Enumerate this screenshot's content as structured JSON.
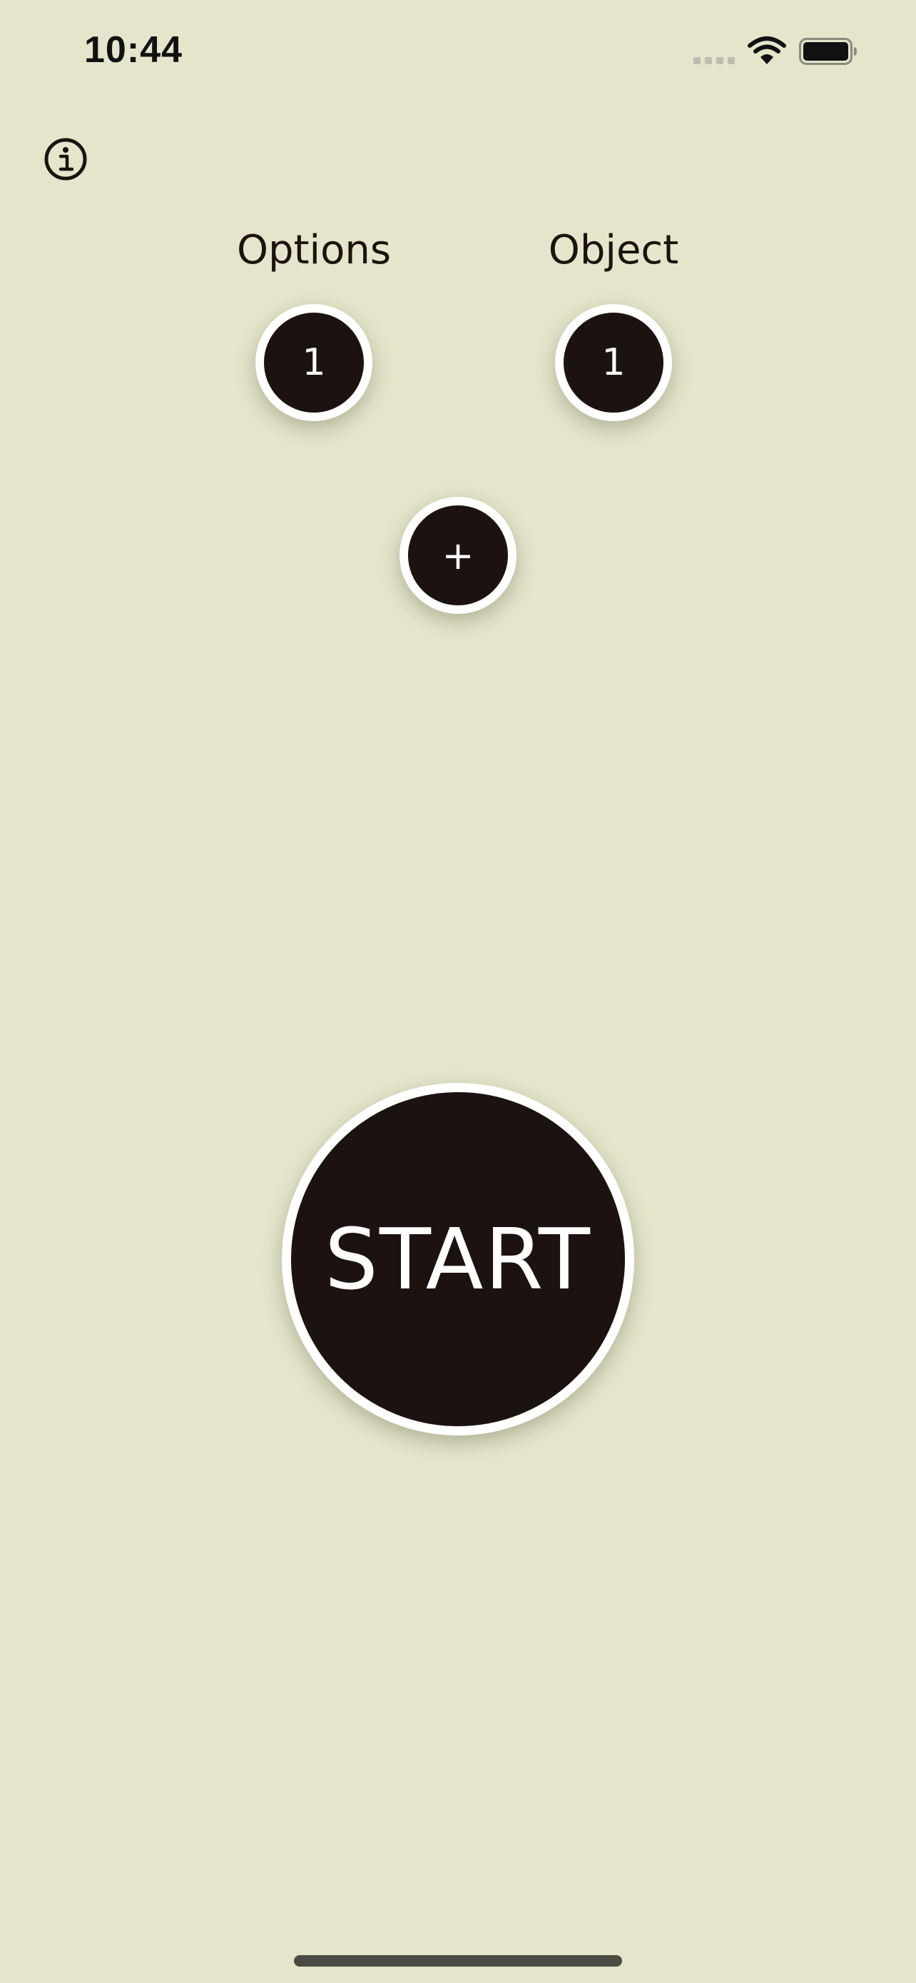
{
  "status_bar": {
    "time": "10:44"
  },
  "header": {
    "info_icon": "info-circle-icon"
  },
  "counters": {
    "options": {
      "label": "Options",
      "value": "1"
    },
    "object": {
      "label": "Object",
      "value": "1"
    }
  },
  "add_button": {
    "label": "+"
  },
  "start_button": {
    "label": "START"
  },
  "colors": {
    "background": "#e5e5cb",
    "button_fill": "#1c1310",
    "button_border": "#ffffff",
    "text": "#1c1310"
  }
}
